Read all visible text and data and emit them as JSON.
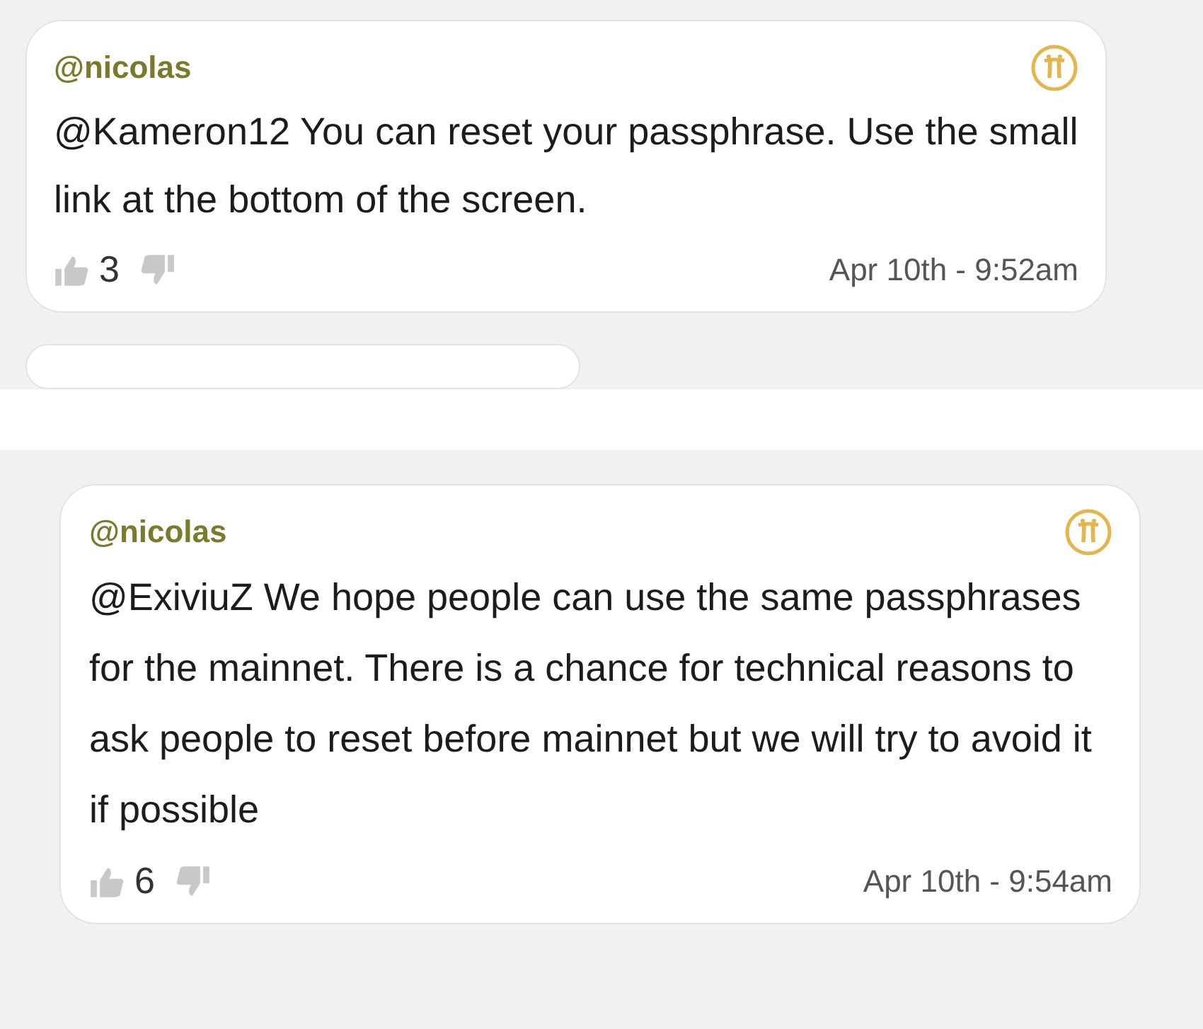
{
  "posts": [
    {
      "author": "@nicolas",
      "text": "@Kameron12 You can reset your passphrase. Use the small link at the bottom of the screen.",
      "likes": "3",
      "timestamp": "Apr 10th - 9:52am"
    },
    {
      "author": "@nicolas",
      "text": "@ExiviuZ We hope people can use the same passphrases for the mainnet. There is a chance for technical reasons to ask people to reset before mainnet but we will try to avoid it if possible",
      "likes": "6",
      "timestamp": "Apr 10th - 9:54am"
    }
  ]
}
